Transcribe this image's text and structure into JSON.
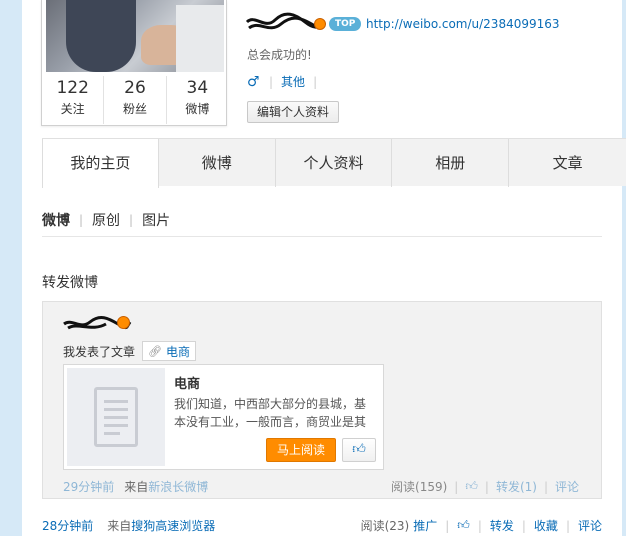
{
  "profile": {
    "stats": [
      {
        "num": "122",
        "label": "关注"
      },
      {
        "num": "26",
        "label": "粉丝"
      },
      {
        "num": "34",
        "label": "微博"
      }
    ],
    "top_badge": "TOP",
    "url": "http://weibo.com/u/2384099163",
    "signature": "总会成功的!",
    "gender_symbol": "♂",
    "other_link": "其他",
    "edit_button": "编辑个人资料"
  },
  "tabs": [
    "我的主页",
    "微博",
    "个人资料",
    "相册",
    "文章"
  ],
  "subnav": {
    "items": [
      "微博",
      "原创",
      "图片"
    ]
  },
  "section_title": "转发微博",
  "repost": {
    "text": "我发表了文章",
    "tag_label": "电商",
    "article": {
      "title": "电商",
      "summary": "我们知道，中西部大部分的县城，基本没有工业，一般而言，商贸业是其",
      "read_button": "马上阅读",
      "like_icon": "thumbs-up-icon"
    },
    "meta": {
      "time": "29分钟前",
      "from": "来自",
      "source": "新浪长微博"
    },
    "actions": {
      "read": "阅读(159)",
      "repost": "转发(1)",
      "comment": "评论"
    }
  },
  "post_meta": {
    "time": "28分钟前",
    "from": "来自",
    "source": "搜狗高速浏览器"
  },
  "post_actions": {
    "read": "阅读(23)",
    "promote": "推广",
    "repost": "转发",
    "collect": "收藏",
    "comment": "评论"
  },
  "colors": {
    "link": "#0a6cb6",
    "orange": "#ff8c00",
    "light_blue_bg": "#d6e9f7"
  }
}
